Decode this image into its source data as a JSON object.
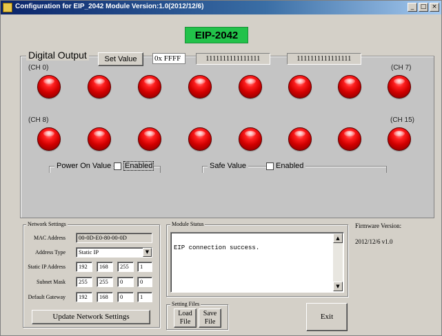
{
  "window": {
    "title": "Configuration for EIP_2042 Module Version:1.0(2012/12/6)",
    "controls": {
      "minimize": "_",
      "maximize": "□",
      "close": "×"
    }
  },
  "banner": {
    "text": "EIP-2042",
    "color": "#22c24a"
  },
  "digital_output": {
    "title": "Digital Output",
    "set_value_label": "Set Value",
    "hex_value": "0x FFFF",
    "bits_low": "1111111111111111",
    "bits_high": "1111111111111111",
    "channel_labels": {
      "ch0": "(CH 0)",
      "ch7": "(CH 7)",
      "ch8": "(CH 8)",
      "ch15": "(CH 15)"
    },
    "led_color": "#e00000",
    "power_on": {
      "title": "Power On Value",
      "checkbox_label": "Enabled",
      "checked": false
    },
    "safe_value": {
      "title": "Safe Value",
      "checkbox_label": "Enabled",
      "checked": false
    }
  },
  "network": {
    "title": "Network Settings",
    "mac_label": "MAC Address",
    "mac_value": "00-0D-E0-80-00-0D",
    "address_type_label": "Address Type",
    "address_type_value": "Static IP",
    "static_ip_label": "Static IP Address",
    "static_ip": [
      "192",
      "168",
      "255",
      "1"
    ],
    "subnet_label": "Subnet Mask",
    "subnet": [
      "255",
      "255",
      "0",
      "0"
    ],
    "gateway_label": "Default Gateway",
    "gateway": [
      "192",
      "168",
      "0",
      "1"
    ],
    "update_button": "Update Network Settings"
  },
  "module_status": {
    "title": "Module Status",
    "text": "EIP connection success."
  },
  "setting_files": {
    "title": "Setting Files",
    "load_line1": "Load",
    "load_line2": "File",
    "save_line1": "Save",
    "save_line2": "File"
  },
  "firmware": {
    "label": "Firmware Version:",
    "value": "2012/12/6 v1.0"
  },
  "exit_label": "Exit"
}
